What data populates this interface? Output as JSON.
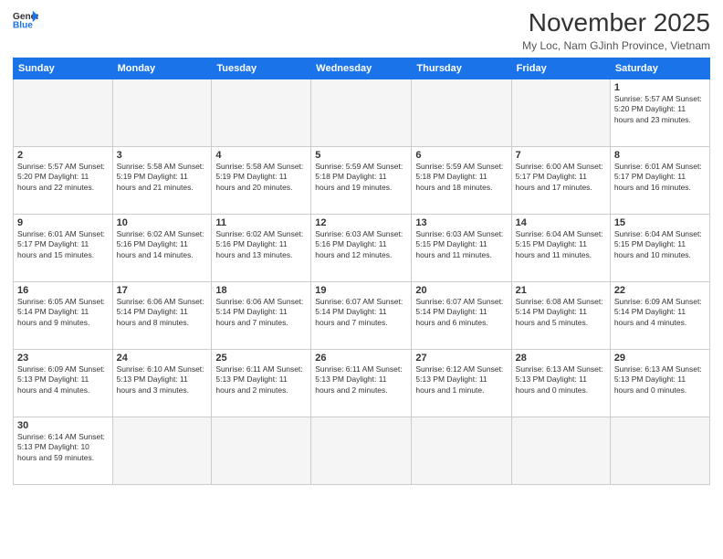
{
  "header": {
    "logo_line1": "General",
    "logo_line2": "Blue",
    "title": "November 2025",
    "subtitle": "My Loc, Nam GJinh Province, Vietnam"
  },
  "weekdays": [
    "Sunday",
    "Monday",
    "Tuesday",
    "Wednesday",
    "Thursday",
    "Friday",
    "Saturday"
  ],
  "weeks": [
    [
      {
        "day": "",
        "info": ""
      },
      {
        "day": "",
        "info": ""
      },
      {
        "day": "",
        "info": ""
      },
      {
        "day": "",
        "info": ""
      },
      {
        "day": "",
        "info": ""
      },
      {
        "day": "",
        "info": ""
      },
      {
        "day": "1",
        "info": "Sunrise: 5:57 AM\nSunset: 5:20 PM\nDaylight: 11 hours\nand 23 minutes."
      }
    ],
    [
      {
        "day": "2",
        "info": "Sunrise: 5:57 AM\nSunset: 5:20 PM\nDaylight: 11 hours\nand 22 minutes."
      },
      {
        "day": "3",
        "info": "Sunrise: 5:58 AM\nSunset: 5:19 PM\nDaylight: 11 hours\nand 21 minutes."
      },
      {
        "day": "4",
        "info": "Sunrise: 5:58 AM\nSunset: 5:19 PM\nDaylight: 11 hours\nand 20 minutes."
      },
      {
        "day": "5",
        "info": "Sunrise: 5:59 AM\nSunset: 5:18 PM\nDaylight: 11 hours\nand 19 minutes."
      },
      {
        "day": "6",
        "info": "Sunrise: 5:59 AM\nSunset: 5:18 PM\nDaylight: 11 hours\nand 18 minutes."
      },
      {
        "day": "7",
        "info": "Sunrise: 6:00 AM\nSunset: 5:17 PM\nDaylight: 11 hours\nand 17 minutes."
      },
      {
        "day": "8",
        "info": "Sunrise: 6:01 AM\nSunset: 5:17 PM\nDaylight: 11 hours\nand 16 minutes."
      }
    ],
    [
      {
        "day": "9",
        "info": "Sunrise: 6:01 AM\nSunset: 5:17 PM\nDaylight: 11 hours\nand 15 minutes."
      },
      {
        "day": "10",
        "info": "Sunrise: 6:02 AM\nSunset: 5:16 PM\nDaylight: 11 hours\nand 14 minutes."
      },
      {
        "day": "11",
        "info": "Sunrise: 6:02 AM\nSunset: 5:16 PM\nDaylight: 11 hours\nand 13 minutes."
      },
      {
        "day": "12",
        "info": "Sunrise: 6:03 AM\nSunset: 5:16 PM\nDaylight: 11 hours\nand 12 minutes."
      },
      {
        "day": "13",
        "info": "Sunrise: 6:03 AM\nSunset: 5:15 PM\nDaylight: 11 hours\nand 11 minutes."
      },
      {
        "day": "14",
        "info": "Sunrise: 6:04 AM\nSunset: 5:15 PM\nDaylight: 11 hours\nand 11 minutes."
      },
      {
        "day": "15",
        "info": "Sunrise: 6:04 AM\nSunset: 5:15 PM\nDaylight: 11 hours\nand 10 minutes."
      }
    ],
    [
      {
        "day": "16",
        "info": "Sunrise: 6:05 AM\nSunset: 5:14 PM\nDaylight: 11 hours\nand 9 minutes."
      },
      {
        "day": "17",
        "info": "Sunrise: 6:06 AM\nSunset: 5:14 PM\nDaylight: 11 hours\nand 8 minutes."
      },
      {
        "day": "18",
        "info": "Sunrise: 6:06 AM\nSunset: 5:14 PM\nDaylight: 11 hours\nand 7 minutes."
      },
      {
        "day": "19",
        "info": "Sunrise: 6:07 AM\nSunset: 5:14 PM\nDaylight: 11 hours\nand 7 minutes."
      },
      {
        "day": "20",
        "info": "Sunrise: 6:07 AM\nSunset: 5:14 PM\nDaylight: 11 hours\nand 6 minutes."
      },
      {
        "day": "21",
        "info": "Sunrise: 6:08 AM\nSunset: 5:14 PM\nDaylight: 11 hours\nand 5 minutes."
      },
      {
        "day": "22",
        "info": "Sunrise: 6:09 AM\nSunset: 5:14 PM\nDaylight: 11 hours\nand 4 minutes."
      }
    ],
    [
      {
        "day": "23",
        "info": "Sunrise: 6:09 AM\nSunset: 5:13 PM\nDaylight: 11 hours\nand 4 minutes."
      },
      {
        "day": "24",
        "info": "Sunrise: 6:10 AM\nSunset: 5:13 PM\nDaylight: 11 hours\nand 3 minutes."
      },
      {
        "day": "25",
        "info": "Sunrise: 6:11 AM\nSunset: 5:13 PM\nDaylight: 11 hours\nand 2 minutes."
      },
      {
        "day": "26",
        "info": "Sunrise: 6:11 AM\nSunset: 5:13 PM\nDaylight: 11 hours\nand 2 minutes."
      },
      {
        "day": "27",
        "info": "Sunrise: 6:12 AM\nSunset: 5:13 PM\nDaylight: 11 hours\nand 1 minute."
      },
      {
        "day": "28",
        "info": "Sunrise: 6:13 AM\nSunset: 5:13 PM\nDaylight: 11 hours\nand 0 minutes."
      },
      {
        "day": "29",
        "info": "Sunrise: 6:13 AM\nSunset: 5:13 PM\nDaylight: 11 hours\nand 0 minutes."
      }
    ],
    [
      {
        "day": "30",
        "info": "Sunrise: 6:14 AM\nSunset: 5:13 PM\nDaylight: 10 hours\nand 59 minutes."
      },
      {
        "day": "",
        "info": ""
      },
      {
        "day": "",
        "info": ""
      },
      {
        "day": "",
        "info": ""
      },
      {
        "day": "",
        "info": ""
      },
      {
        "day": "",
        "info": ""
      },
      {
        "day": "",
        "info": ""
      }
    ]
  ]
}
